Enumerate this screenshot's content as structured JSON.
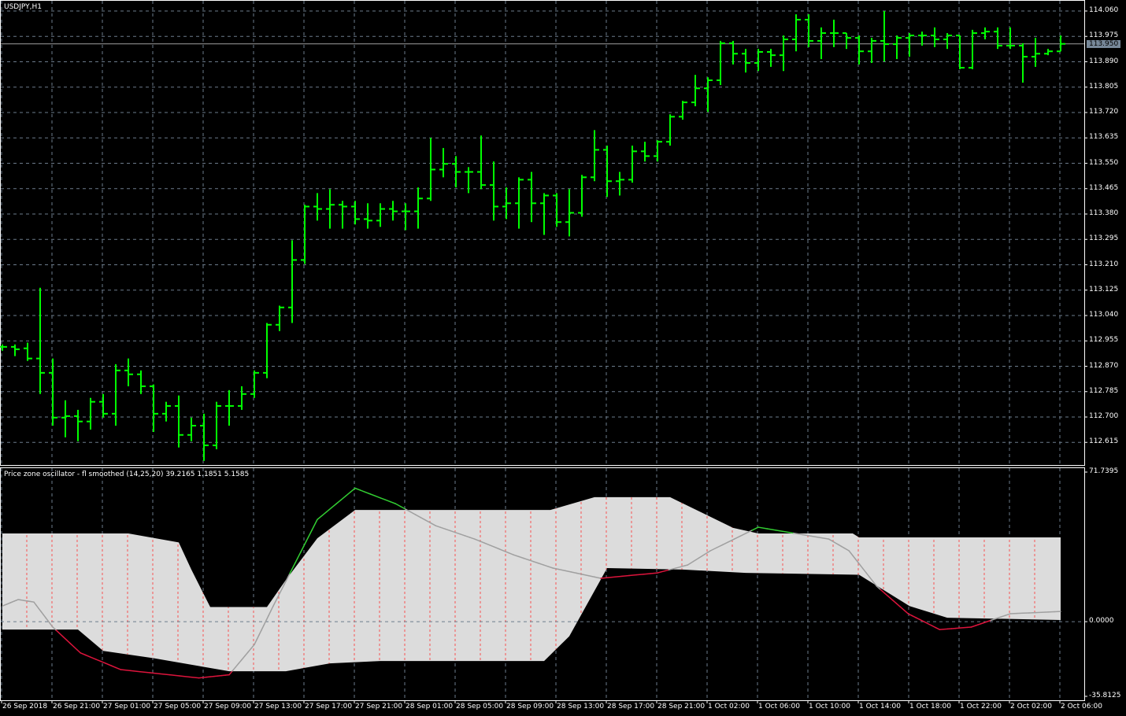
{
  "main_chart": {
    "title": "USDJPY,H1",
    "current_price": "113.950",
    "price_ticks": [
      "114.060",
      "113.975",
      "113.890",
      "113.805",
      "113.720",
      "113.635",
      "113.550",
      "113.465",
      "113.380",
      "113.295",
      "113.210",
      "113.125",
      "113.040",
      "112.955",
      "112.870",
      "112.785",
      "112.700",
      "112.615"
    ],
    "bar_color": "#00ff00",
    "bars_ohlc": [
      [
        112.935,
        112.943,
        112.922,
        112.935
      ],
      [
        112.935,
        112.943,
        112.904,
        112.927
      ],
      [
        112.93,
        112.949,
        112.888,
        112.896
      ],
      [
        112.896,
        113.133,
        112.777,
        112.848
      ],
      [
        112.848,
        112.896,
        112.671,
        112.698
      ],
      [
        112.698,
        112.756,
        112.632,
        112.703
      ],
      [
        112.703,
        112.724,
        112.619,
        112.685
      ],
      [
        112.685,
        112.764,
        112.658,
        112.751
      ],
      [
        112.751,
        112.777,
        112.698,
        112.711
      ],
      [
        112.711,
        112.877,
        112.671,
        112.856
      ],
      [
        112.856,
        112.896,
        112.803,
        112.843
      ],
      [
        112.843,
        112.856,
        112.777,
        112.803
      ],
      [
        112.803,
        112.809,
        112.65,
        112.711
      ],
      [
        112.711,
        112.751,
        112.685,
        112.737
      ],
      [
        112.737,
        112.772,
        112.598,
        112.64
      ],
      [
        112.64,
        112.698,
        112.619,
        112.671
      ],
      [
        112.671,
        112.711,
        112.553,
        112.605
      ],
      [
        112.605,
        112.751,
        112.592,
        112.737
      ],
      [
        112.737,
        112.79,
        112.671,
        112.737
      ],
      [
        112.737,
        112.803,
        112.724,
        112.777
      ],
      [
        112.777,
        112.856,
        112.764,
        112.848
      ],
      [
        112.848,
        113.015,
        112.83,
        113.009
      ],
      [
        113.009,
        113.073,
        112.988,
        113.067
      ],
      [
        113.067,
        113.292,
        113.015,
        113.226
      ],
      [
        113.226,
        113.411,
        113.213,
        113.405
      ],
      [
        113.405,
        113.45,
        113.358,
        113.397
      ],
      [
        113.397,
        113.463,
        113.331,
        113.411
      ],
      [
        113.411,
        113.424,
        113.331,
        113.405
      ],
      [
        113.405,
        113.424,
        113.345,
        113.363
      ],
      [
        113.363,
        113.416,
        113.331,
        113.358
      ],
      [
        113.358,
        113.416,
        113.337,
        113.397
      ],
      [
        113.397,
        113.424,
        113.358,
        113.389
      ],
      [
        113.389,
        113.416,
        113.326,
        113.389
      ],
      [
        113.389,
        113.469,
        113.331,
        113.432
      ],
      [
        113.432,
        113.635,
        113.424,
        113.529
      ],
      [
        113.529,
        113.601,
        113.503,
        113.548
      ],
      [
        113.548,
        113.574,
        113.469,
        113.521
      ],
      [
        113.521,
        113.537,
        113.45,
        113.521
      ],
      [
        113.521,
        113.643,
        113.463,
        113.477
      ],
      [
        113.477,
        113.556,
        113.358,
        113.405
      ],
      [
        113.405,
        113.469,
        113.363,
        113.416
      ],
      [
        113.416,
        113.503,
        113.331,
        113.495
      ],
      [
        113.495,
        113.521,
        113.353,
        113.416
      ],
      [
        113.416,
        113.45,
        113.31,
        113.442
      ],
      [
        113.442,
        113.45,
        113.337,
        113.353
      ],
      [
        113.353,
        113.463,
        113.305,
        113.384
      ],
      [
        113.384,
        113.511,
        113.371,
        113.503
      ],
      [
        113.503,
        113.661,
        113.49,
        113.595
      ],
      [
        113.595,
        113.609,
        113.437,
        113.49
      ],
      [
        113.49,
        113.521,
        113.442,
        113.495
      ],
      [
        113.495,
        113.609,
        113.485,
        113.59
      ],
      [
        113.59,
        113.622,
        113.556,
        113.574
      ],
      [
        113.574,
        113.627,
        113.556,
        113.622
      ],
      [
        113.622,
        113.714,
        113.609,
        113.706
      ],
      [
        113.706,
        113.759,
        113.696,
        113.754
      ],
      [
        113.754,
        113.846,
        113.741,
        113.801
      ],
      [
        113.801,
        113.838,
        113.722,
        113.828
      ],
      [
        113.828,
        113.96,
        113.812,
        113.952
      ],
      [
        113.952,
        113.96,
        113.881,
        113.917
      ],
      [
        113.917,
        113.933,
        113.854,
        113.886
      ],
      [
        113.886,
        113.933,
        113.859,
        113.923
      ],
      [
        113.923,
        113.933,
        113.873,
        113.912
      ],
      [
        113.912,
        113.978,
        113.859,
        113.965
      ],
      [
        113.965,
        114.049,
        113.925,
        114.031
      ],
      [
        114.031,
        114.049,
        113.939,
        113.96
      ],
      [
        113.96,
        114.005,
        113.899,
        113.986
      ],
      [
        113.986,
        114.031,
        113.939,
        113.986
      ],
      [
        113.986,
        113.986,
        113.933,
        113.97
      ],
      [
        113.97,
        113.978,
        113.881,
        113.925
      ],
      [
        113.925,
        113.97,
        113.886,
        113.96
      ],
      [
        113.96,
        114.06,
        113.891,
        113.949
      ],
      [
        113.949,
        113.978,
        113.899,
        113.97
      ],
      [
        113.97,
        113.986,
        113.907,
        113.978
      ],
      [
        113.978,
        113.991,
        113.944,
        113.978
      ],
      [
        113.978,
        114.005,
        113.939,
        113.965
      ],
      [
        113.965,
        113.986,
        113.933,
        113.978
      ],
      [
        113.978,
        113.978,
        113.865,
        113.87
      ],
      [
        113.87,
        113.997,
        113.865,
        113.986
      ],
      [
        113.986,
        114.005,
        113.965,
        113.991
      ],
      [
        113.991,
        114.005,
        113.933,
        113.944
      ],
      [
        113.944,
        114.005,
        113.933,
        113.944
      ],
      [
        113.944,
        113.952,
        113.82,
        113.907
      ],
      [
        113.907,
        113.97,
        113.873,
        113.917
      ],
      [
        113.917,
        113.933,
        113.912,
        113.925
      ],
      [
        113.925,
        113.978,
        113.925,
        113.95
      ]
    ]
  },
  "indicator": {
    "label": "Price zone oscillator - fl smoothed (14,25,20) 39.2165 1.1851 5.1585",
    "ticks": [
      "71.7395",
      "0.0000",
      "-35.8125"
    ],
    "range": [
      -35.8125,
      71.7395
    ],
    "colors": {
      "band": "#dcdcdc",
      "neutral": "#a0a0a0",
      "up": "#32cd32",
      "down": "#dc143c",
      "bar_lines": "#ff3030"
    },
    "band_upper": [
      [
        0,
        42.3
      ],
      [
        10,
        42.3
      ],
      [
        14,
        38
      ],
      [
        15,
        25
      ],
      [
        16.5,
        7
      ],
      [
        21,
        7
      ],
      [
        22.5,
        20
      ],
      [
        25,
        40
      ],
      [
        28,
        53.6
      ],
      [
        43.5,
        53.6
      ],
      [
        47,
        59.7
      ],
      [
        53,
        59.7
      ],
      [
        58,
        45
      ],
      [
        60,
        42.3
      ],
      [
        67.5,
        42.3
      ],
      [
        68,
        40.4
      ],
      [
        84,
        40.4
      ]
    ],
    "band_lower": [
      [
        0,
        -3.8
      ],
      [
        6,
        -3.8
      ],
      [
        8,
        -14
      ],
      [
        12,
        -17.5
      ],
      [
        18,
        -23.8
      ],
      [
        22.5,
        -23.8
      ],
      [
        26,
        -20
      ],
      [
        30,
        -18.9
      ],
      [
        43,
        -18.9
      ],
      [
        45,
        -7
      ],
      [
        48,
        25.7
      ],
      [
        54,
        25
      ],
      [
        59,
        23.4
      ],
      [
        68,
        22.5
      ],
      [
        72,
        7.5
      ],
      [
        75,
        1.9
      ],
      [
        84,
        0.8
      ]
    ],
    "oscillator": [
      [
        0,
        7.5
      ],
      [
        1.25,
        10.6
      ],
      [
        2.5,
        9.4
      ],
      [
        4,
        -2.6
      ],
      [
        6.2,
        -15
      ],
      [
        9.4,
        -23
      ],
      [
        15.6,
        -27
      ],
      [
        18,
        -25.5
      ],
      [
        20,
        -11
      ],
      [
        21.5,
        7.5
      ],
      [
        25,
        49
      ],
      [
        28,
        64
      ],
      [
        31.2,
        56.6
      ],
      [
        34.4,
        46
      ],
      [
        37.5,
        39.6
      ],
      [
        40.6,
        32
      ],
      [
        43.7,
        25.7
      ],
      [
        47.5,
        20.8
      ],
      [
        52,
        23.4
      ],
      [
        54.4,
        27.2
      ],
      [
        56.2,
        34
      ],
      [
        60,
        45.3
      ],
      [
        65.6,
        39.6
      ],
      [
        67.2,
        34
      ],
      [
        69.4,
        17
      ],
      [
        71.9,
        3.8
      ],
      [
        74.4,
        -3.8
      ],
      [
        76.9,
        -2.6
      ],
      [
        80,
        3.8
      ],
      [
        84,
        4.9
      ]
    ]
  },
  "time_axis": {
    "labels": [
      "26 Sep 2018",
      "26 Sep 21:00",
      "27 Sep 01:00",
      "27 Sep 05:00",
      "27 Sep 09:00",
      "27 Sep 13:00",
      "27 Sep 17:00",
      "27 Sep 21:00",
      "28 Sep 01:00",
      "28 Sep 05:00",
      "28 Sep 09:00",
      "28 Sep 13:00",
      "28 Sep 17:00",
      "28 Sep 21:00",
      "1 Oct 02:00",
      "1 Oct 06:00",
      "1 Oct 10:00",
      "1 Oct 14:00",
      "1 Oct 18:00",
      "1 Oct 22:00",
      "2 Oct 02:00",
      "2 Oct 06:00"
    ]
  }
}
